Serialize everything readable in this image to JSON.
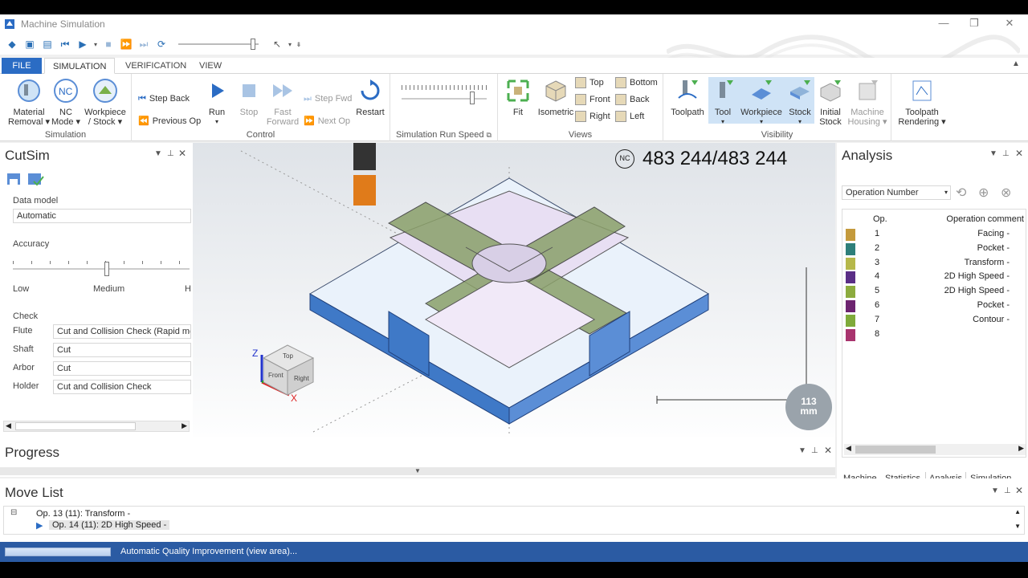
{
  "app": {
    "title": "Machine Simulation"
  },
  "window_controls": {
    "minimize": "—",
    "restore": "❐",
    "close": "✕"
  },
  "ribbon_tabs": [
    {
      "label": "FILE"
    },
    {
      "label": "SIMULATION"
    },
    {
      "label": "VERIFICATION"
    },
    {
      "label": "VIEW"
    }
  ],
  "ribbon": {
    "simulation": {
      "group": "Simulation",
      "material_removal": "Material\nRemoval ▾",
      "nc_mode": "NC\nMode ▾",
      "workpiece_stock": "Workpiece\n/ Stock ▾"
    },
    "control": {
      "group": "Control",
      "step_back": "Step Back",
      "previous_op": "Previous Op",
      "run": "Run",
      "stop": "Stop",
      "fast_forward": "Fast\nForward",
      "step_fwd": "Step Fwd",
      "next_op": "Next Op",
      "restart": "Restart"
    },
    "speed": {
      "group": "Simulation Run Speed",
      "value": 0.85
    },
    "views": {
      "group": "Views",
      "fit": "Fit",
      "isometric": "Isometric",
      "top": "Top",
      "bottom": "Bottom",
      "front": "Front",
      "back": "Back",
      "right": "Right",
      "left": "Left"
    },
    "visibility": {
      "group": "Visibility",
      "toolpath": "Toolpath",
      "tool": "Tool",
      "workpiece": "Workpiece",
      "stock": "Stock",
      "initial_stock": "Initial\nStock",
      "machine_housing": "Machine\nHousing ▾",
      "toolpath_rendering": "Toolpath\nRendering ▾"
    }
  },
  "cutsim": {
    "title": "CutSim",
    "data_model_label": "Data model",
    "data_model": "Automatic",
    "accuracy_label": "Accuracy",
    "acc_low": "Low",
    "acc_medium": "Medium",
    "acc_high": "H",
    "check_label": "Check",
    "rows": [
      {
        "label": "Flute",
        "value": "Cut and Collision Check (Rapid mo"
      },
      {
        "label": "Shaft",
        "value": "Cut"
      },
      {
        "label": "Arbor",
        "value": "Cut"
      },
      {
        "label": "Holder",
        "value": "Cut and Collision Check"
      }
    ]
  },
  "view": {
    "counter": "483 244/483 244",
    "nc_badge": "NC",
    "scale": "113\nmm",
    "axes": {
      "z": "Z",
      "x": "X"
    },
    "cube": {
      "top": "Top",
      "front": "Front",
      "right": "Right"
    }
  },
  "analysis": {
    "title": "Analysis",
    "dropdown": "Operation Number",
    "col_op": "Op.",
    "col_comment": "Operation comment",
    "rows": [
      {
        "op": "1",
        "comment": "Facing -",
        "color": "#c49a3c"
      },
      {
        "op": "2",
        "comment": "Pocket -",
        "color": "#2e7f7a"
      },
      {
        "op": "3",
        "comment": "Transform -",
        "color": "#b6b84a"
      },
      {
        "op": "4",
        "comment": "2D High Speed -",
        "color": "#5a2e86"
      },
      {
        "op": "5",
        "comment": "2D High Speed -",
        "color": "#8cab3e"
      },
      {
        "op": "6",
        "comment": "Pocket -",
        "color": "#6d2470"
      },
      {
        "op": "7",
        "comment": "Contour -",
        "color": "#7faa3a"
      },
      {
        "op": "8",
        "comment": "",
        "color": "#a8346e"
      }
    ],
    "bottom_tabs": [
      {
        "label": "Machine",
        "color": "#f2c94c"
      },
      {
        "label": "Statistics",
        "color": "#8bc34a"
      },
      {
        "label": "Analysis",
        "color": "#e57373"
      },
      {
        "label": "Simulation",
        "color": "#90caf9"
      }
    ]
  },
  "progress": {
    "title": "Progress"
  },
  "movelist": {
    "title": "Move List",
    "item1": "Op. 13 (11): Transform -",
    "item2": "Op. 14 (11): 2D High Speed -"
  },
  "status": {
    "text": "Automatic Quality Improvement (view area)..."
  }
}
